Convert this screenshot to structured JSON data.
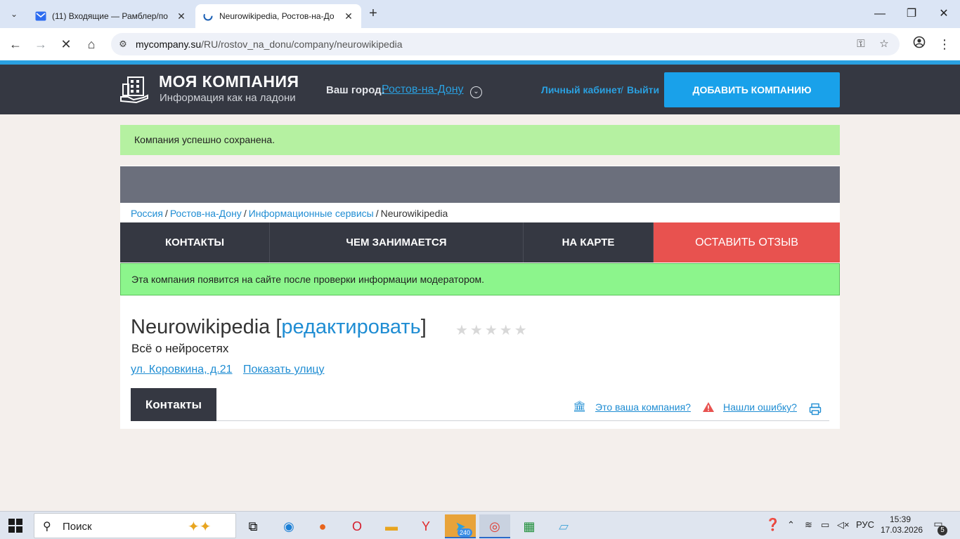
{
  "browser": {
    "tabs": [
      {
        "title": "(11) Входящие — Рамблер/по",
        "active": false
      },
      {
        "title": "Neurowikipedia, Ростов-на-До",
        "active": true
      }
    ],
    "url_host": "mycompany.su",
    "url_path": "/RU/rostov_na_donu/company/neurowikipedia"
  },
  "site": {
    "logo_title": "МОЯ КОМПАНИЯ",
    "logo_subtitle": "Информация как на ладони",
    "city_label": "Ваш город:",
    "city_value": "Ростов-на-Дону",
    "account_link": "Личный кабинет",
    "account_sep": "/",
    "logout_link": "Выйти",
    "add_company_button": "ДОБАВИТЬ КОМПАНИЮ",
    "accent_color": "#19a1ea"
  },
  "content": {
    "success_message": "Компания успешно сохранена.",
    "breadcrumb": [
      "Россия",
      "Ростов-на-Дону",
      "Информационные сервисы",
      "Neurowikipedia"
    ],
    "nav_tabs": [
      "КОНТАКТЫ",
      "ЧЕМ ЗАНИМАЕТСЯ",
      "НА КАРТЕ",
      "ОСТАВИТЬ ОТЗЫВ"
    ],
    "moderation_message": "Эта компания появится на сайте после проверки информации модератором.",
    "company_name": "Neurowikipedia",
    "edit_link": "редактировать",
    "rating": 0,
    "rating_max": 5,
    "description": "Всё о нейросетях",
    "address": "ул. Коровкина, д.21",
    "show_street_link": "Показать улицу",
    "contacts_button": "Контакты",
    "your_company_link": "Это ваша компания?",
    "found_error_link": "Нашли ошибку?"
  },
  "taskbar": {
    "search_placeholder": "Поиск",
    "telegram_badge": "240",
    "language": "РУС",
    "time": "15:39",
    "date": "17.03.2026",
    "notifications_count": "5"
  }
}
